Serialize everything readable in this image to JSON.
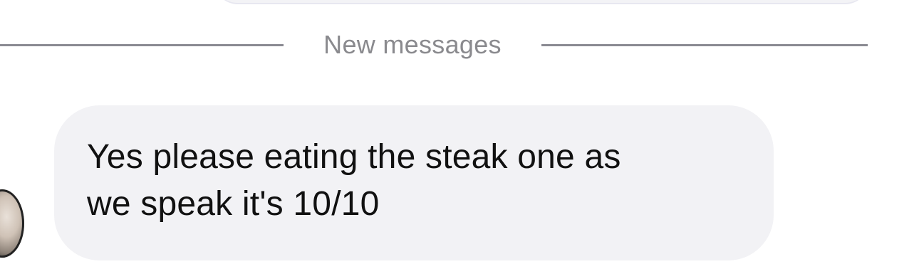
{
  "divider": {
    "label": "New messages"
  },
  "messages": [
    {
      "text": "Yes please eating the steak one as\nwe speak it's 10/10"
    }
  ]
}
